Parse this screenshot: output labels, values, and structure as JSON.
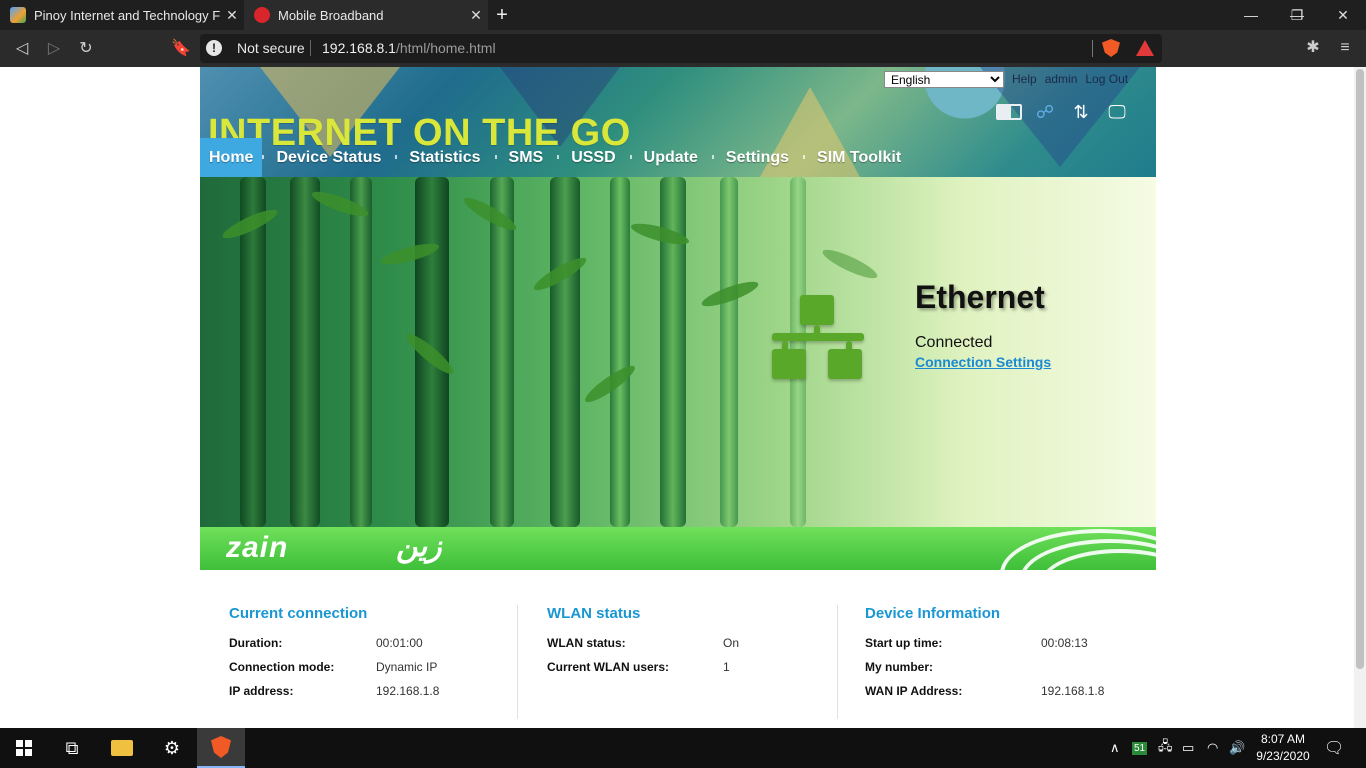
{
  "browser": {
    "tabs": [
      {
        "title": "Pinoy Internet and Technology For",
        "close": "✕"
      },
      {
        "title": "Mobile Broadband",
        "close": "✕"
      }
    ],
    "new_tab": "+",
    "window_controls": [
      "—",
      "❐",
      "✕"
    ],
    "url": {
      "security": "Not secure",
      "host": "192.168.8.1",
      "path": "/html/home.html"
    }
  },
  "router": {
    "slogan": "INTERNET ON THE GO",
    "language": {
      "selected": "English",
      "options": [
        "English"
      ]
    },
    "top_links": [
      "Help",
      "admin",
      "Log Out"
    ],
    "nav": [
      "Home",
      "Device Status",
      "Statistics",
      "SMS",
      "USSD",
      "Update",
      "Settings",
      "SIM Toolkit"
    ],
    "active_nav": "Home",
    "connection": {
      "title": "Ethernet",
      "status": "Connected",
      "link": "Connection Settings"
    },
    "brand": {
      "latin": "zain",
      "arabic": "زين"
    },
    "panels": {
      "current_connection": {
        "title": "Current connection",
        "rows": [
          {
            "label": "Duration:",
            "value": "00:01:00"
          },
          {
            "label": "Connection mode:",
            "value": "Dynamic IP"
          },
          {
            "label": "IP address:",
            "value": "192.168.1.8"
          }
        ]
      },
      "wlan_status": {
        "title": "WLAN status",
        "rows": [
          {
            "label": "WLAN status:",
            "value": "On"
          },
          {
            "label": "Current WLAN users:",
            "value": "1"
          }
        ]
      },
      "device_information": {
        "title": "Device Information",
        "rows": [
          {
            "label": "Start up time:",
            "value": "00:08:13"
          },
          {
            "label": "My number:",
            "value": ""
          },
          {
            "label": "WAN IP Address:",
            "value": "192.168.1.8"
          }
        ]
      }
    }
  },
  "taskbar": {
    "tray_badge": "51",
    "time": "8:07 AM",
    "date": "9/23/2020"
  },
  "colors": {
    "accent": "#1a97d3",
    "nav_active": "#3ea9e0",
    "slogan": "#d9e63a",
    "band": "#3fbf3a"
  }
}
